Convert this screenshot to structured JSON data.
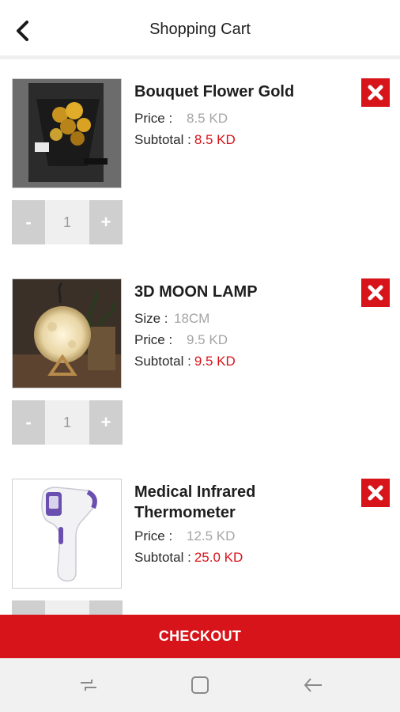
{
  "header": {
    "title": "Shopping Cart",
    "back_icon": "chevron-left-icon"
  },
  "items": [
    {
      "name": "Bouquet Flower Gold",
      "price_label": "Price :",
      "price": "8.5 KD",
      "subtotal_label": "Subtotal :",
      "subtotal": "8.5 KD",
      "quantity": "1",
      "minus": "-",
      "plus": "+",
      "image": "gold-rose-bouquet-photo"
    },
    {
      "name": "3D MOON LAMP",
      "size_label": "Size :",
      "size": "18CM",
      "price_label": "Price :",
      "price": "9.5 KD",
      "subtotal_label": "Subtotal :",
      "subtotal": "9.5 KD",
      "quantity": "1",
      "minus": "-",
      "plus": "+",
      "image": "moon-lamp-photo"
    },
    {
      "name_line1": "Medical Infrared",
      "name_line2": "Thermometer",
      "price_label": "Price :",
      "price": "12.5 KD",
      "subtotal_label": "Subtotal :",
      "subtotal": "25.0 KD",
      "image": "infrared-thermometer-photo"
    }
  ],
  "checkout": {
    "label": "CHECKOUT"
  },
  "navbar": {
    "recent_icon": "recent-apps-icon",
    "home_icon": "home-icon",
    "back_icon": "back-arrow-icon"
  },
  "colors": {
    "accent": "#d7141a",
    "muted": "#a5a5a5",
    "stepper": "#cfcfcf"
  }
}
